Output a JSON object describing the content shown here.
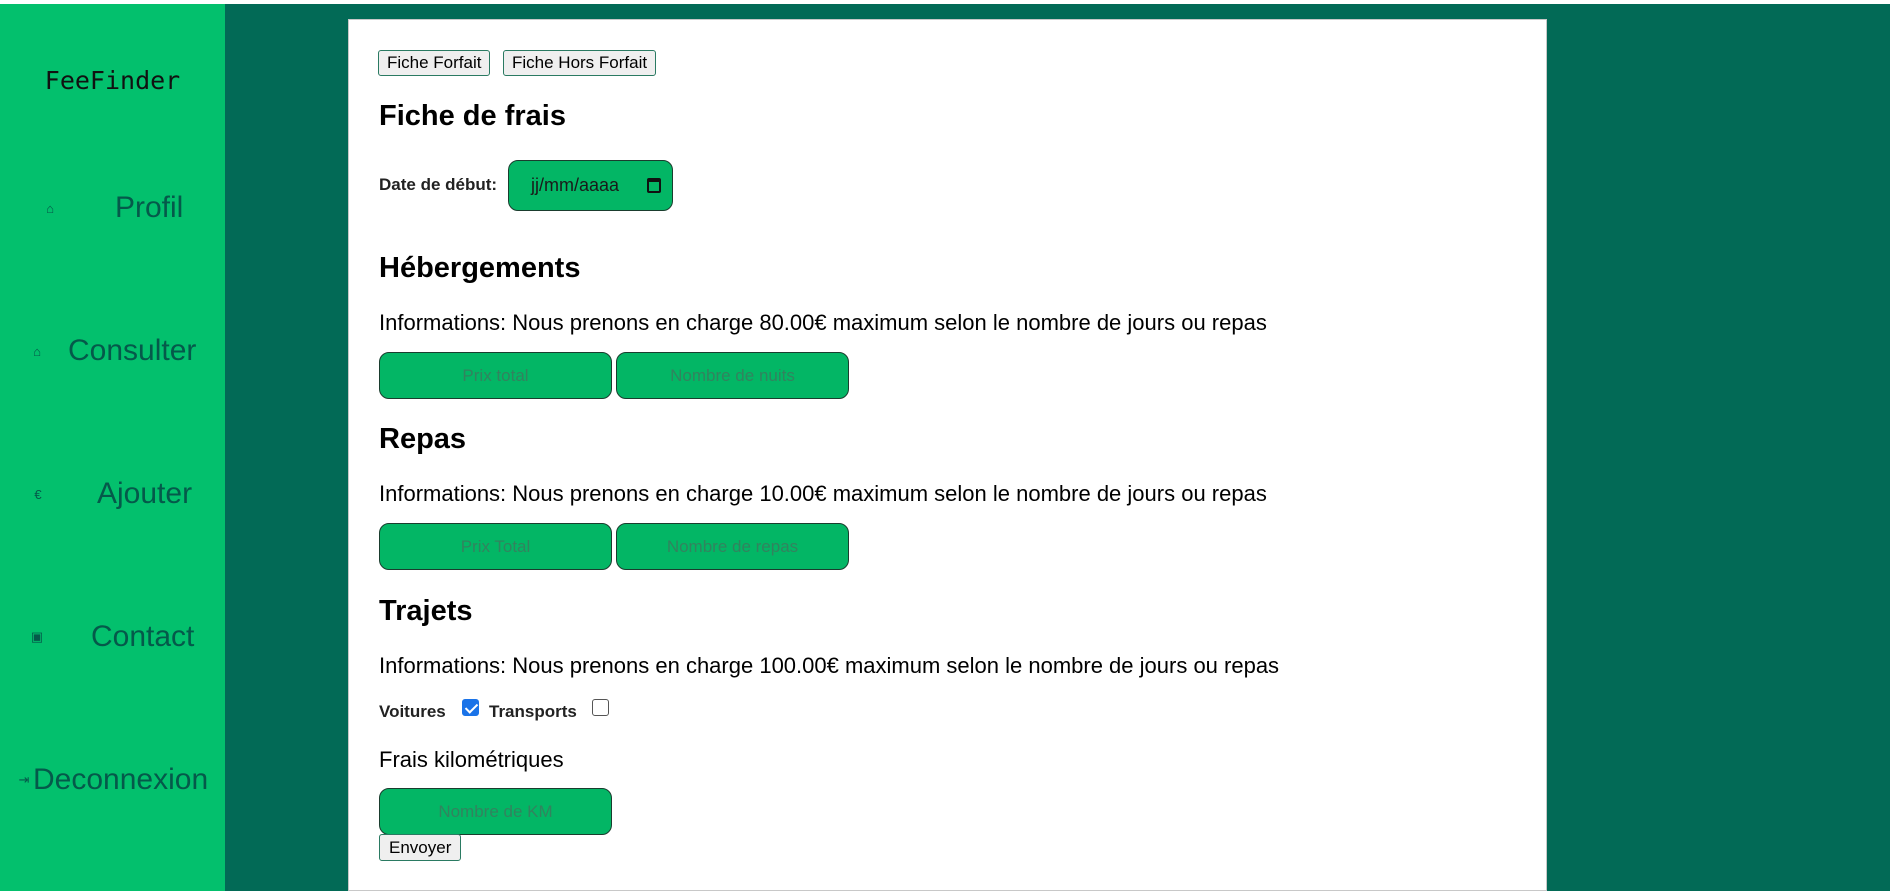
{
  "sidebar": {
    "logo": "FeeFinder",
    "items": [
      {
        "label": "Profil",
        "icon": "home-icon",
        "glyph": "⌂"
      },
      {
        "label": "Consulter",
        "icon": "home-icon",
        "glyph": "⌂"
      },
      {
        "label": "Ajouter",
        "icon": "euro-icon",
        "glyph": "€"
      },
      {
        "label": "Contact",
        "icon": "contact-card-icon",
        "glyph": "▣"
      },
      {
        "label": "Deconnexion",
        "icon": "logout-icon",
        "glyph": "⇥"
      }
    ]
  },
  "tabs": {
    "forfait": "Fiche Forfait",
    "hors_forfait": "Fiche Hors Forfait"
  },
  "form": {
    "title": "Fiche de frais",
    "date_label": "Date de début:",
    "date_placeholder": "jj/mm/aaaa",
    "hebergements": {
      "title": "Hébergements",
      "info": "Informations: Nous prenons en charge 80.00€ maximum selon le nombre de jours ou repas",
      "price_placeholder": "Prix total",
      "count_placeholder": "Nombre de nuits"
    },
    "repas": {
      "title": "Repas",
      "info": "Informations: Nous prenons en charge 10.00€ maximum selon le nombre de jours ou repas",
      "price_placeholder": "Prix Total",
      "count_placeholder": "Nombre de repas"
    },
    "trajets": {
      "title": "Trajets",
      "info": "Informations: Nous prenons en charge 100.00€ maximum selon le nombre de jours ou repas",
      "voitures_label": "Voitures",
      "voitures_checked": true,
      "transports_label": "Transports",
      "transports_checked": false,
      "km_label": "Frais kilométriques",
      "km_placeholder": "Nombre de KM"
    },
    "submit_label": "Envoyer"
  },
  "colors": {
    "sidebar": "#03c06d",
    "background": "#026a56",
    "field": "#03b665",
    "nav_text": "#05594a"
  }
}
